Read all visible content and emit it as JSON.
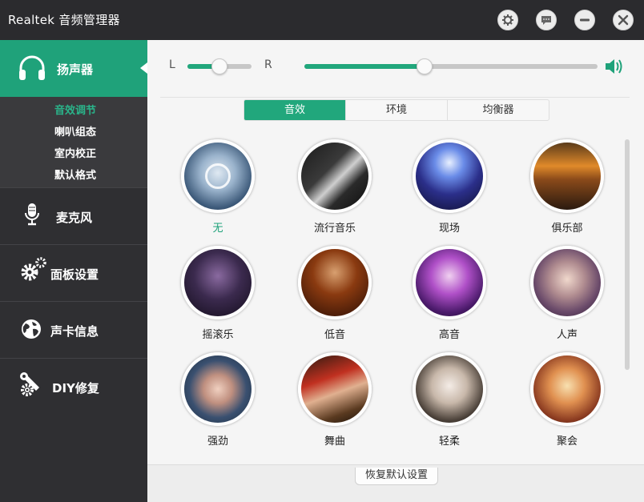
{
  "window": {
    "title": "Realtek 音频管理器"
  },
  "titlebar": {
    "buttons": [
      {
        "name": "settings",
        "icon": "gear-icon"
      },
      {
        "name": "feedback",
        "icon": "chat-bubble-icon"
      },
      {
        "name": "minimize",
        "icon": "minus-icon"
      },
      {
        "name": "close",
        "icon": "close-icon"
      }
    ]
  },
  "sidebar": {
    "speakers": {
      "label": "扬声器",
      "icon": "headphones-icon"
    },
    "subnav": [
      "音效调节",
      "喇叭组态",
      "室内校正",
      "默认格式"
    ],
    "items": [
      {
        "label": "麦克风",
        "icon": "microphone-icon"
      },
      {
        "label": "面板设置",
        "icon": "gears-icon"
      },
      {
        "label": "声卡信息",
        "icon": "globe-icon"
      },
      {
        "label": "DIY修复",
        "icon": "wrench-gear-icon"
      }
    ]
  },
  "controls": {
    "balance": {
      "left_label": "L",
      "right_label": "R",
      "value": 0.5
    },
    "volume": {
      "value": 0.41,
      "icon": "speaker-volume-icon"
    }
  },
  "tabs": [
    {
      "label": "音效",
      "active": true
    },
    {
      "label": "环境",
      "active": false
    },
    {
      "label": "均衡器",
      "active": false
    }
  ],
  "presets": [
    {
      "label": "无",
      "active": true
    },
    {
      "label": "流行音乐",
      "active": false
    },
    {
      "label": "现场",
      "active": false
    },
    {
      "label": "俱乐部",
      "active": false
    },
    {
      "label": "摇滚乐",
      "active": false
    },
    {
      "label": "低音",
      "active": false
    },
    {
      "label": "高音",
      "active": false
    },
    {
      "label": "人声",
      "active": false
    },
    {
      "label": "强劲",
      "active": false
    },
    {
      "label": "舞曲",
      "active": false
    },
    {
      "label": "轻柔",
      "active": false
    },
    {
      "label": "聚会",
      "active": false
    }
  ],
  "footer": {
    "restore_label": "恢复默认设置"
  },
  "colors": {
    "accent": "#1fa27a",
    "sidebar": "#2f2f32",
    "titlebar": "#2b2b2e"
  }
}
